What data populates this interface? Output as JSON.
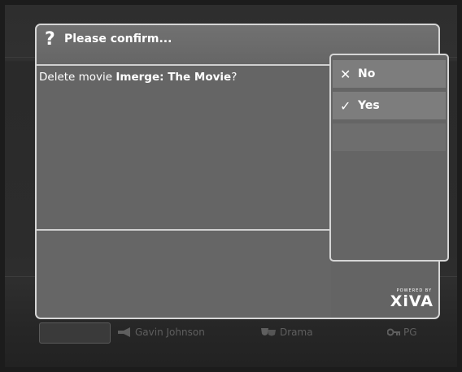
{
  "dialog": {
    "header_icon": "?",
    "title": "Please confirm...",
    "message_prefix": "Delete movie ",
    "movie_title": "Imerge: The Movie",
    "message_suffix": "?"
  },
  "options": [
    {
      "icon": "x-icon",
      "glyph": "✕",
      "label": "No"
    },
    {
      "icon": "check-icon",
      "glyph": "✓",
      "label": "Yes"
    }
  ],
  "logo": {
    "powered": "POWERED BY",
    "brand": "XiVA"
  },
  "background": {
    "director": "Gavin Johnson",
    "genre": "Drama",
    "rating": "PG"
  },
  "colors": {
    "dialog_bg": "#646464",
    "border": "#d6d6d6",
    "option_bg": "#7d7d7d",
    "text": "#ffffff"
  }
}
